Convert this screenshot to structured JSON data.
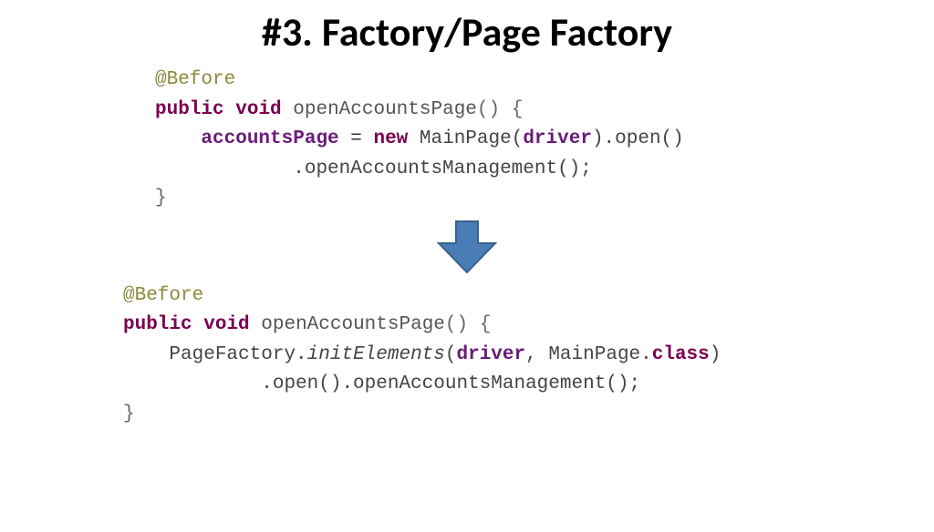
{
  "title": "#3. Factory/Page Factory",
  "code1": {
    "ann": "@Before",
    "kw_public": "public",
    "kw_void": "void",
    "method": "openAccountsPage",
    "sig_tail": "() {",
    "field": "accountsPage",
    "eq": " = ",
    "kw_new": "new",
    "mainpage": " MainPage(",
    "driver": "driver",
    "open_chain": ").open()",
    "dot_chain": ".openAccountsManagement();",
    "close_brace": "}"
  },
  "code2": {
    "ann": "@Before",
    "kw_public": "public",
    "kw_void": "void",
    "method": "openAccountsPage",
    "sig_tail": "() {",
    "pagefactory": "PageFactory.",
    "initelements": "initElements",
    "lpar": "(",
    "driver": "driver",
    "comma": ", MainPage.",
    "kw_class": "class",
    "rpar": ")",
    "dot_chain": ".open().openAccountsManagement();",
    "close_brace": "}"
  }
}
